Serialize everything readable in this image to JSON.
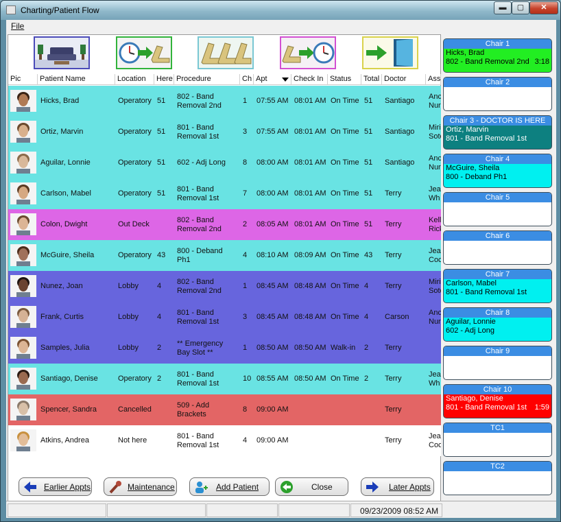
{
  "window": {
    "title": "Charting/Patient Flow",
    "min_glyph": "▬",
    "max_glyph": "▢",
    "close_glyph": "✕"
  },
  "menu": {
    "file": "File"
  },
  "toolbar": [
    "waiting-room",
    "seat-patient",
    "chairs",
    "dismiss-patient",
    "exit-door"
  ],
  "columns": [
    "Pic",
    "Patient Name",
    "Location",
    "Here",
    "Procedure",
    "Ch",
    "Apt",
    "Check In",
    "Status",
    "Total",
    "Doctor",
    "Ass"
  ],
  "rows": [
    {
      "name": "Hicks, Brad",
      "location": "Operatory",
      "here": "51",
      "procedure": "802 - Band Removal 2nd",
      "ch": "1",
      "apt": "07:55 AM",
      "checkin": "08:01 AM",
      "status": "On Time",
      "total": "51",
      "doctor": "Santiago",
      "assist": "Anc Nur",
      "color": "#69e3e3",
      "skin": "#b07a55",
      "hair": "#3a2416"
    },
    {
      "name": "Ortiz, Marvin",
      "location": "Operatory",
      "here": "51",
      "procedure": "801 - Band Removal 1st",
      "ch": "3",
      "apt": "07:55 AM",
      "checkin": "08:01 AM",
      "status": "On Time",
      "total": "51",
      "doctor": "Santiago",
      "assist": "Miri Soto",
      "color": "#69e3e3",
      "skin": "#d9b08c",
      "hair": "#6b4a2e"
    },
    {
      "name": "Aguilar, Lonnie",
      "location": "Operatory",
      "here": "51",
      "procedure": "602 - Adj Long",
      "ch": "8",
      "apt": "08:00 AM",
      "checkin": "08:01 AM",
      "status": "On Time",
      "total": "51",
      "doctor": "Santiago",
      "assist": "Anc Nur",
      "color": "#69e3e3",
      "skin": "#d9b89a",
      "hair": "#8a6a4a"
    },
    {
      "name": "Carlson, Mabel",
      "location": "Operatory",
      "here": "51",
      "procedure": "801 - Band Removal 1st",
      "ch": "7",
      "apt": "08:00 AM",
      "checkin": "08:01 AM",
      "status": "On Time",
      "total": "51",
      "doctor": "Terry",
      "assist": "Jea Wh",
      "color": "#69e3e3",
      "skin": "#d6a882",
      "hair": "#5a3a22"
    },
    {
      "name": "Colon, Dwight",
      "location": "Out Deck",
      "here": "",
      "procedure": "802 - Band Removal 2nd",
      "ch": "2",
      "apt": "08:05 AM",
      "checkin": "08:01 AM",
      "status": "On Time",
      "total": "51",
      "doctor": "Terry",
      "assist": "Kell Rick",
      "color": "#dd66e6",
      "skin": "#dcb595",
      "hair": "#6a4a30"
    },
    {
      "name": "McGuire, Sheila",
      "location": "Operatory",
      "here": "43",
      "procedure": "800 - Deband Ph1",
      "ch": "4",
      "apt": "08:10 AM",
      "checkin": "08:09 AM",
      "status": "On Time",
      "total": "43",
      "doctor": "Terry",
      "assist": "Jea Coc",
      "color": "#69e3e3",
      "skin": "#a0705a",
      "hair": "#4a2a1a"
    },
    {
      "name": "Nunez, Joan",
      "location": "Lobby",
      "here": "4",
      "procedure": "802 - Band Removal 2nd",
      "ch": "1",
      "apt": "08:45 AM",
      "checkin": "08:48 AM",
      "status": "On Time",
      "total": "4",
      "doctor": "Terry",
      "assist": "Miri Soto",
      "color": "#6765dd",
      "skin": "#6a4330",
      "hair": "#1e1410"
    },
    {
      "name": "Frank, Curtis",
      "location": "Lobby",
      "here": "4",
      "procedure": "801 - Band Removal 1st",
      "ch": "3",
      "apt": "08:45 AM",
      "checkin": "08:48 AM",
      "status": "On Time",
      "total": "4",
      "doctor": "Carson",
      "assist": "Anc Nur",
      "color": "#6765dd",
      "skin": "#d5b295",
      "hair": "#7a5a3e"
    },
    {
      "name": "Samples, Julia",
      "location": "Lobby",
      "here": "2",
      "procedure": "** Emergency Bay Slot **",
      "ch": "1",
      "apt": "08:50 AM",
      "checkin": "08:50 AM",
      "status": "Walk-in",
      "total": "2",
      "doctor": "Terry",
      "assist": "",
      "color": "#6765dd",
      "skin": "#dcb595",
      "hair": "#7a5232"
    },
    {
      "name": "Santiago, Denise",
      "location": "Operatory",
      "here": "2",
      "procedure": "801 - Band Removal 1st",
      "ch": "10",
      "apt": "08:55 AM",
      "checkin": "08:50 AM",
      "status": "On Time",
      "total": "2",
      "doctor": "Terry",
      "assist": "Jea Wh",
      "color": "#69e3e3",
      "skin": "#9a6a50",
      "hair": "#2a1a12"
    },
    {
      "name": "Spencer, Sandra",
      "location": "Cancelled",
      "here": "",
      "procedure": "509 - Add Brackets",
      "ch": "8",
      "apt": "09:00 AM",
      "checkin": "",
      "status": "",
      "total": "",
      "doctor": "Terry",
      "assist": "",
      "color": "#e36565",
      "skin": "#d8c0a8",
      "hair": "#8a7a6a"
    },
    {
      "name": "Atkins, Andrea",
      "location": "Not here",
      "here": "",
      "procedure": "801 - Band Removal 1st",
      "ch": "4",
      "apt": "09:00 AM",
      "checkin": "",
      "status": "",
      "total": "",
      "doctor": "Terry",
      "assist": "Jea Coc",
      "color": "#ffffff",
      "skin": "#e2bd99",
      "hair": "#c8913f"
    }
  ],
  "chairs": [
    {
      "title": "Chair 1",
      "name": "Hicks, Brad",
      "procedure": "802 - Band Removal 2nd",
      "time": "3:18",
      "bg": "#22ee22",
      "fg": "#000000"
    },
    {
      "title": "Chair 2",
      "name": "",
      "procedure": "",
      "time": "",
      "bg": "#ffffff",
      "fg": "#000000"
    },
    {
      "title": "Chair 3 - DOCTOR IS HERE",
      "name": "Ortiz, Marvin",
      "procedure": "801 - Band Removal 1st",
      "time": "",
      "bg": "#0d8080",
      "fg": "#ffffff"
    },
    {
      "title": "Chair 4",
      "name": "McGuire, Sheila",
      "procedure": "800 - Deband Ph1",
      "time": "",
      "bg": "#00f0f0",
      "fg": "#000000"
    },
    {
      "title": "Chair 5",
      "name": "",
      "procedure": "",
      "time": "",
      "bg": "#ffffff",
      "fg": "#000000"
    },
    {
      "title": "Chair 6",
      "name": "",
      "procedure": "",
      "time": "",
      "bg": "#ffffff",
      "fg": "#000000"
    },
    {
      "title": "Chair 7",
      "name": "Carlson, Mabel",
      "procedure": "801 - Band Removal 1st",
      "time": "",
      "bg": "#00f0f0",
      "fg": "#000000"
    },
    {
      "title": "Chair 8",
      "name": "Aguilar, Lonnie",
      "procedure": "602 - Adj Long",
      "time": "",
      "bg": "#00f0f0",
      "fg": "#000000"
    },
    {
      "title": "Chair 9",
      "name": "",
      "procedure": "",
      "time": "",
      "bg": "#ffffff",
      "fg": "#000000"
    },
    {
      "title": "Chair 10",
      "name": "Santiago, Denise",
      "procedure": "801 - Band Removal 1st",
      "time": "1:59",
      "bg": "#ff0000",
      "fg": "#ffffff"
    },
    {
      "title": "TC1",
      "name": "",
      "procedure": "",
      "time": "",
      "bg": "#ffffff",
      "fg": "#000000"
    },
    {
      "title": "TC2",
      "name": "",
      "procedure": "",
      "time": "",
      "bg": "#ffffff",
      "fg": "#000000"
    }
  ],
  "buttons": {
    "earlier": "Earlier Appts",
    "maintenance": "Maintenance",
    "add_patient": "Add Patient",
    "close": "Close",
    "later": "Later Appts"
  },
  "status_bar": {
    "datetime": "09/23/2009 08:52 AM"
  }
}
